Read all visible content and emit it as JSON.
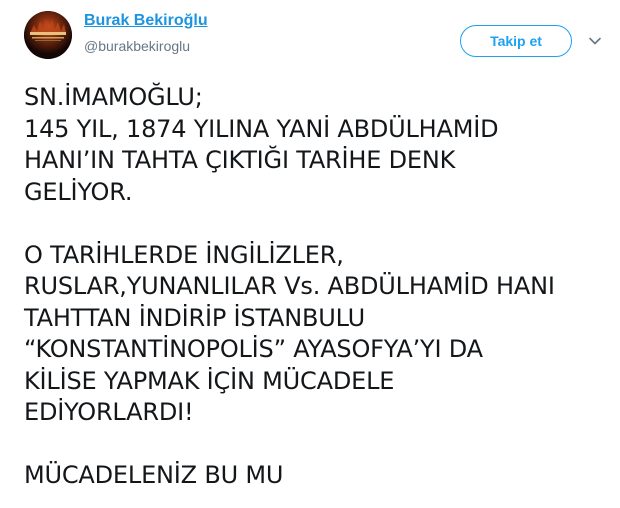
{
  "author": {
    "name": "Burak Bekiroğlu",
    "handle": "@burakbekiroglu",
    "avatar_icon": "profile-avatar"
  },
  "actions": {
    "follow_label": "Takip et",
    "menu_icon": "chevron-down-icon"
  },
  "colors": {
    "link": "#1c94e0",
    "accent": "#1da1f2",
    "handle": "#657786",
    "text": "#14171a"
  },
  "tweet": {
    "paragraph_1": [
      "SN.İMAMOĞLU;",
      "145 YIL, 1874 YILINA YANİ ABDÜLHAMİD",
      "HANI’IN TAHTA ÇIKTIĞI TARİHE DENK",
      "GELİYOR."
    ],
    "paragraph_2": [
      "O TARİHLERDE İNGİLİZLER,",
      "RUSLAR,YUNANLILAR Vs. ABDÜLHAMİD HANI",
      "TAHTTAN İNDİRİP İSTANBULU",
      "“KONSTANTİNOPOLİS” AYASOFYA’YI DA",
      "KİLİSE YAPMAK İÇİN MÜCADELE",
      "EDİYORLARDI!"
    ],
    "paragraph_3": [
      "MÜCADELENİZ BU MU"
    ]
  }
}
